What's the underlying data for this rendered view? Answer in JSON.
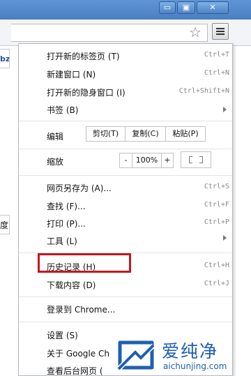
{
  "window": {
    "min_glyph": "▭",
    "max_glyph": "▣",
    "close_glyph": "✕",
    "bg_fragment_top": "bz",
    "bg_fragment_mid": "度"
  },
  "toolbar": {
    "star_icon": "☆"
  },
  "menu": {
    "new_tab": "打开新的标签页 (T)",
    "new_tab_sc": "Ctrl+T",
    "new_window": "新建窗口 (N)",
    "new_window_sc": "Ctrl+N",
    "incognito": "打开新的隐身窗口 (I)",
    "incognito_sc": "Ctrl+Shift+N",
    "bookmarks": "书签 (B)",
    "edit_label": "编辑",
    "cut": "剪切(T)",
    "copy": "复制(C)",
    "paste": "粘贴(P)",
    "zoom_label": "缩放",
    "zoom_minus": "-",
    "zoom_value": "100%",
    "zoom_plus": "+",
    "save_as": "网页另存为 (A)...",
    "save_as_sc": "Ctrl+S",
    "find": "查找 (F)...",
    "find_sc": "Ctrl+F",
    "print": "打印 (P)...",
    "print_sc": "Ctrl+P",
    "tools": "工具 (L)",
    "history": "历史记录 (H)",
    "history_sc": "Ctrl+H",
    "downloads": "下载内容 (D)",
    "downloads_sc": "Ctrl+J",
    "sign_in": "登录到 Chrome...",
    "settings": "设置 (S)",
    "about": "关于 Google Ch",
    "background_pages": "查看后台网页 ("
  },
  "watermark": {
    "cn": "爱纯净",
    "en": "aichunjing.com"
  },
  "colors": {
    "highlight": "#c5161f",
    "titlebar": "#4a7fc2",
    "watermark": "#1f5fb3"
  }
}
